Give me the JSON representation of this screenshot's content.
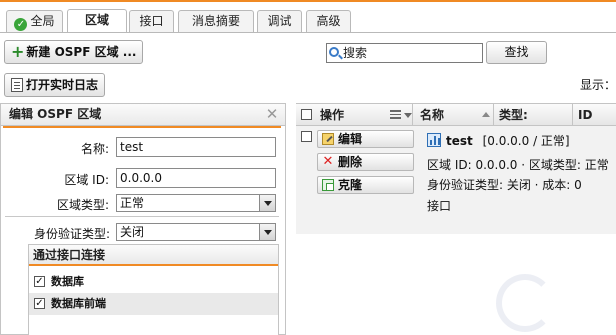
{
  "tabs": [
    {
      "label": "全局",
      "active": false,
      "icon": "check-circle-icon"
    },
    {
      "label": "区域",
      "active": true
    },
    {
      "label": "接口",
      "active": false
    },
    {
      "label": "消息摘要",
      "active": false
    },
    {
      "label": "调试",
      "active": false
    },
    {
      "label": "高级",
      "active": false
    }
  ],
  "toolbar": {
    "new_area_label": "新建 OSPF 区域 ...",
    "open_log_label": "打开实时日志",
    "search_placeholder": "搜索",
    "search_button": "查找",
    "display_label": "显示："
  },
  "edit_panel": {
    "title": "编辑 OSPF 区域",
    "name_label": "名称:",
    "name_value": "test",
    "area_id_label": "区域 ID:",
    "area_id_value": "0.0.0.0",
    "area_type_label": "区域类型:",
    "area_type_value": "正常",
    "auth_type_label": "身份验证类型:",
    "auth_type_value": "关闭",
    "connections": {
      "title": "通过接口连接",
      "items": [
        {
          "label": "数据库",
          "checked": true
        },
        {
          "label": "数据库前端",
          "checked": true
        }
      ]
    }
  },
  "grid": {
    "columns": {
      "actions": "操作",
      "name": "名称",
      "type": "类型:",
      "id": "ID"
    },
    "row": {
      "edit_label": "编辑",
      "delete_label": "删除",
      "clone_label": "克隆",
      "name": "test",
      "name_suffix": "[0.0.0.0 / 正常]",
      "detail_line1": "区域 ID: 0.0.0.0 · 区域类型: 正常",
      "detail_line2": "身份验证类型: 关闭 · 成本: 0",
      "detail_line3": "接口"
    }
  },
  "colors": {
    "accent": "#f08a24",
    "check_green": "#3aa53a",
    "delete_red": "#dd2222"
  }
}
